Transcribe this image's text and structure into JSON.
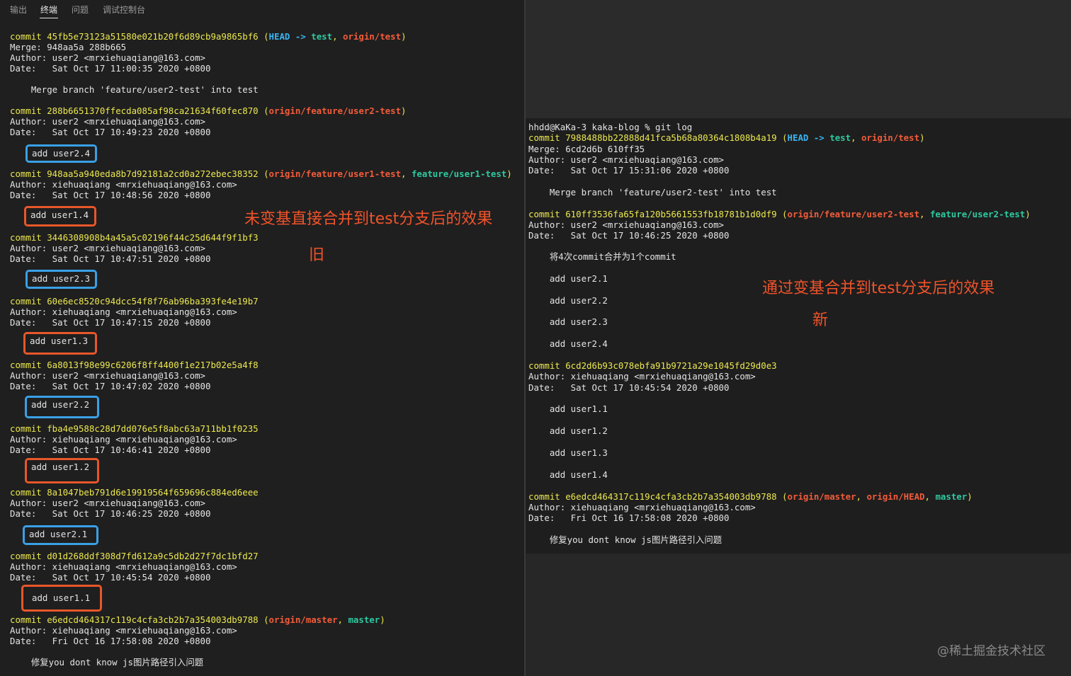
{
  "tabs": [
    {
      "label": "输出"
    },
    {
      "label": "终端"
    },
    {
      "label": "问题"
    },
    {
      "label": "调试控制台"
    }
  ],
  "left": {
    "c1": {
      "hash": "commit 45fb5e73123a51580e021b20f6d89cb9a9865bf6",
      "p1": " (",
      "head": "HEAD -> ",
      "br1": "test",
      "sep": ", ",
      "br2": "origin/test",
      "p2": ")"
    },
    "c1_merge": "Merge: 948aa5a 288b665",
    "c1_author": "Author: user2 <mrxiehuaqiang@163.com>",
    "c1_date": "Date:   Sat Oct 17 11:00:35 2020 +0800",
    "c1_msg": "    Merge branch 'feature/user2-test' into test",
    "c2": {
      "hash": "commit 288b6651370ffecda085af98ca21634f60fec870",
      "p1": " (",
      "br1": "origin/feature/user2-test",
      "p2": ")"
    },
    "c2_author": "Author: user2 <mrxiehuaqiang@163.com>",
    "c2_date": "Date:   Sat Oct 17 10:49:23 2020 +0800",
    "c2_msg": "add user2.4",
    "c3": {
      "hash": "commit 948aa5a940eda8b7d92181a2cd0a272ebec38352",
      "p1": " (",
      "br1": "origin/feature/user1-test",
      "sep": ", ",
      "br2": "feature/user1-test",
      "p2": ")"
    },
    "c3_author": "Author: xiehuaqiang <mrxiehuaqiang@163.com>",
    "c3_date": "Date:   Sat Oct 17 10:48:56 2020 +0800",
    "c3_msg": "add user1.4",
    "c4": {
      "hash": "commit 3446308908b4a45a5c02196f44c25d644f9f1bf3"
    },
    "c4_author": "Author: user2 <mrxiehuaqiang@163.com>",
    "c4_date": "Date:   Sat Oct 17 10:47:51 2020 +0800",
    "c4_msg": "add user2.3",
    "c5": {
      "hash": "commit 60e6ec8520c94dcc54f8f76ab96ba393fe4e19b7"
    },
    "c5_author": "Author: xiehuaqiang <mrxiehuaqiang@163.com>",
    "c5_date": "Date:   Sat Oct 17 10:47:15 2020 +0800",
    "c5_msg": "add user1.3",
    "c6": {
      "hash": "commit 6a8013f98e99c6206f8ff4400f1e217b02e5a4f8"
    },
    "c6_author": "Author: user2 <mrxiehuaqiang@163.com>",
    "c6_date": "Date:   Sat Oct 17 10:47:02 2020 +0800",
    "c6_msg": "add user2.2",
    "c7": {
      "hash": "commit fba4e9588c28d7dd076e5f8abc63a711bb1f0235"
    },
    "c7_author": "Author: xiehuaqiang <mrxiehuaqiang@163.com>",
    "c7_date": "Date:   Sat Oct 17 10:46:41 2020 +0800",
    "c7_msg": "add user1.2",
    "c8": {
      "hash": "commit 8a1047beb791d6e19919564f659696c884ed6eee"
    },
    "c8_author": "Author: user2 <mrxiehuaqiang@163.com>",
    "c8_date": "Date:   Sat Oct 17 10:46:25 2020 +0800",
    "c8_msg": "add user2.1",
    "c9": {
      "hash": "commit d01d268ddf308d7fd612a9c5db2d27f7dc1bfd27"
    },
    "c9_author": "Author: xiehuaqiang <mrxiehuaqiang@163.com>",
    "c9_date": "Date:   Sat Oct 17 10:45:54 2020 +0800",
    "c9_msg": "add user1.1",
    "c10": {
      "hash": "commit e6edcd464317c119c4cfa3cb2b7a354003db9788",
      "p1": " (",
      "br1": "origin/master",
      "sep": ", ",
      "br2": "master",
      "p2": ")"
    },
    "c10_author": "Author: xiehuaqiang <mrxiehuaqiang@163.com>",
    "c10_date": "Date:   Fri Oct 16 17:58:08 2020 +0800",
    "c10_msg": "    修复you dont know js图片路径引入问题",
    "annot1": "未变基直接合并到test分支后的效果",
    "annot2": "旧"
  },
  "right": {
    "prompt": "hhdd@KaKa-3 kaka-blog % git log",
    "c1": {
      "hash": "commit 7988488bb22888d41fca5b68a80364c1808b4a19",
      "p1": " (",
      "head": "HEAD -> ",
      "br1": "test",
      "sep": ", ",
      "br2": "origin/test",
      "p2": ")"
    },
    "c1_merge": "Merge: 6cd2d6b 610ff35",
    "c1_author": "Author: user2 <mrxiehuaqiang@163.com>",
    "c1_date": "Date:   Sat Oct 17 15:31:06 2020 +0800",
    "c1_msg": "    Merge branch 'feature/user2-test' into test",
    "c2": {
      "hash": "commit 610ff3536fa65fa120b5661553fb18781b1d0df9",
      "p1": " (",
      "br1": "origin/feature/user2-test",
      "sep": ", ",
      "br2": "feature/user2-test",
      "p2": ")"
    },
    "c2_author": "Author: user2 <mrxiehuaqiang@163.com>",
    "c2_date": "Date:   Sat Oct 17 10:46:25 2020 +0800",
    "c2_m1": "    将4次commit合并为1个commit",
    "c2_m2": "    add user2.1",
    "c2_m3": "    add user2.2",
    "c2_m4": "    add user2.3",
    "c2_m5": "    add user2.4",
    "c3": {
      "hash": "commit 6cd2d6b93c078ebfa91b9721a29e1045fd29d0e3"
    },
    "c3_author": "Author: xiehuaqiang <mrxiehuaqiang@163.com>",
    "c3_date": "Date:   Sat Oct 17 10:45:54 2020 +0800",
    "c3_m1": "    add user1.1",
    "c3_m2": "    add user1.2",
    "c3_m3": "    add user1.3",
    "c3_m4": "    add user1.4",
    "c4": {
      "hash": "commit e6edcd464317c119c4cfa3cb2b7a354003db9788",
      "p1": " (",
      "br1": "origin/master",
      "sep": ", ",
      "br2": "origin/HEAD",
      "sep2": ", ",
      "br3": "master",
      "p2": ")"
    },
    "c4_author": "Author: xiehuaqiang <mrxiehuaqiang@163.com>",
    "c4_date": "Date:   Fri Oct 16 17:58:08 2020 +0800",
    "c4_msg": "    修复you dont know js图片路径引入问题",
    "annot1": "通过变基合并到test分支后的效果",
    "annot2": "新"
  },
  "watermark": "@稀土掘金技术社区",
  "colors": {
    "commit": "#ece84f",
    "head": "#3ab4f2",
    "local_branch": "#2ec9a0",
    "remote_branch": "#f25c3b",
    "box_blue": "#3aa0e6",
    "box_red": "#e8572a",
    "annotation": "#f0532a"
  }
}
